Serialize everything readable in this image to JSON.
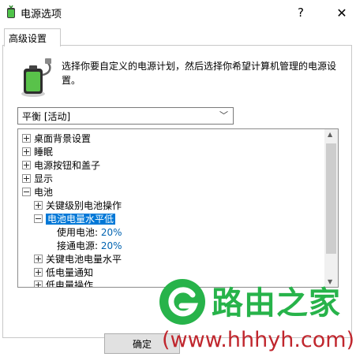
{
  "window": {
    "title": "电源选项",
    "help_label": "?",
    "close_label": "✕"
  },
  "tab": {
    "label": "高级设置"
  },
  "description": "选择你要自定义的电源计划，然后选择你希望计算机管理的电源设置。",
  "plan_select": {
    "value": "平衡 [活动]",
    "chevron": "﹀"
  },
  "tree": {
    "items": [
      {
        "label": "桌面背景设置",
        "expander": "+"
      },
      {
        "label": "睡眠",
        "expander": "+"
      },
      {
        "label": "电源按钮和盖子",
        "expander": "+"
      },
      {
        "label": "显示",
        "expander": "+"
      },
      {
        "label": "电池",
        "expander": "-"
      },
      {
        "label": "关键级别电池操作",
        "expander": "+"
      },
      {
        "label": "电池电量水平低",
        "expander": "-",
        "selected": true
      },
      {
        "label": "使用电池:",
        "value": "20%"
      },
      {
        "label": "接通电源:",
        "value": "20%"
      },
      {
        "label": "关键电池电量水平",
        "expander": "+"
      },
      {
        "label": "低电量通知",
        "expander": "+"
      },
      {
        "label": "低电量操作",
        "expander": "+"
      }
    ]
  },
  "ok_button": {
    "label": "确定"
  },
  "watermark": {
    "title": "路由之家",
    "url": "(www.hhhyh.com)"
  },
  "colors": {
    "selection": "#0078d7",
    "value_text": "#0063b1",
    "watermark_green": "#27b34a",
    "watermark_red": "#c0262d"
  }
}
